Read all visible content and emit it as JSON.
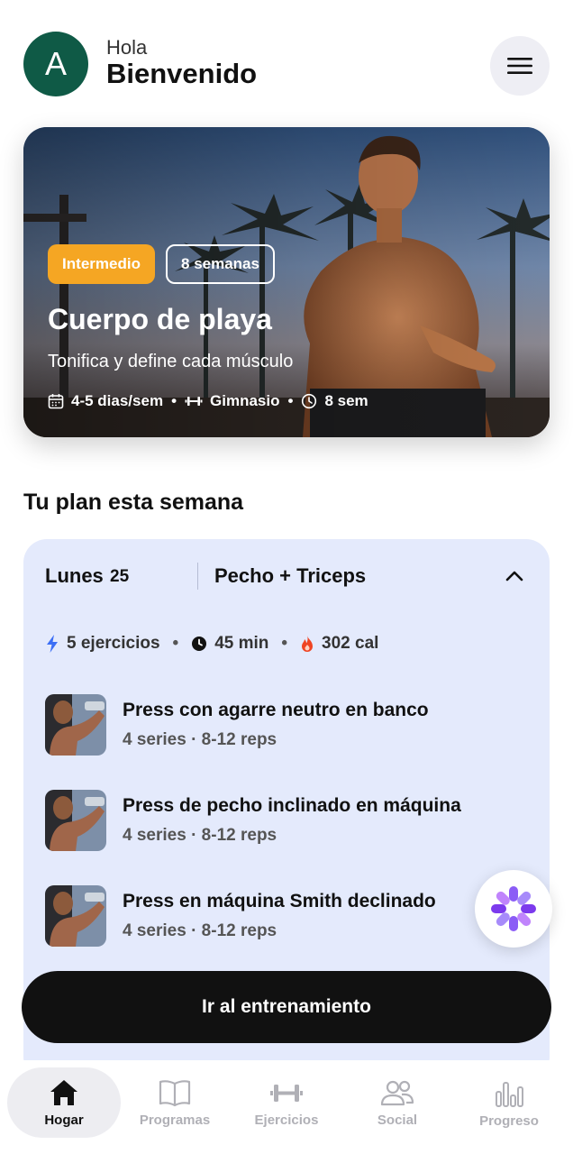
{
  "header": {
    "avatar_letter": "A",
    "greeting": "Hola",
    "welcome": "Bienvenido"
  },
  "program": {
    "level": "Intermedio",
    "duration_badge": "8 semanas",
    "title": "Cuerpo de playa",
    "subtitle": "Tonifica y define cada músculo",
    "frequency": "4-5 dias/sem",
    "location": "Gimnasio",
    "length": "8 sem",
    "separator": "•"
  },
  "plan": {
    "section_title": "Tu plan esta semana",
    "day": "Lunes",
    "day_number": "25",
    "workout": "Pecho + Triceps",
    "stats": {
      "exercises": "5 ejercicios",
      "time": "45 min",
      "calories": "302 cal",
      "separator": "•"
    },
    "exercises": [
      {
        "name": "Press con agarre neutro en banco",
        "detail": "4 series · 8-12 reps"
      },
      {
        "name": "Press de pecho inclinado en máquina",
        "detail": "4 series · 8-12 reps"
      },
      {
        "name": "Press en máquina Smith declinado",
        "detail": "4 series · 8-12 reps"
      }
    ],
    "cta": "Ir al entrenamiento"
  },
  "nav": {
    "items": [
      {
        "label": "Hogar",
        "icon": "home-icon",
        "active": true
      },
      {
        "label": "Programas",
        "icon": "book-icon",
        "active": false
      },
      {
        "label": "Ejercicios",
        "icon": "dumbbell-icon",
        "active": false
      },
      {
        "label": "Social",
        "icon": "people-icon",
        "active": false
      },
      {
        "label": "Progreso",
        "icon": "bar-chart-icon",
        "active": false
      }
    ]
  },
  "colors": {
    "avatar": "#0f5a46",
    "badge_level": "#f5a623",
    "plan_card": "#e4eafc",
    "cta": "#111111",
    "accent_bolt": "#3b6ef5",
    "accent_fire": "#ef4423"
  }
}
